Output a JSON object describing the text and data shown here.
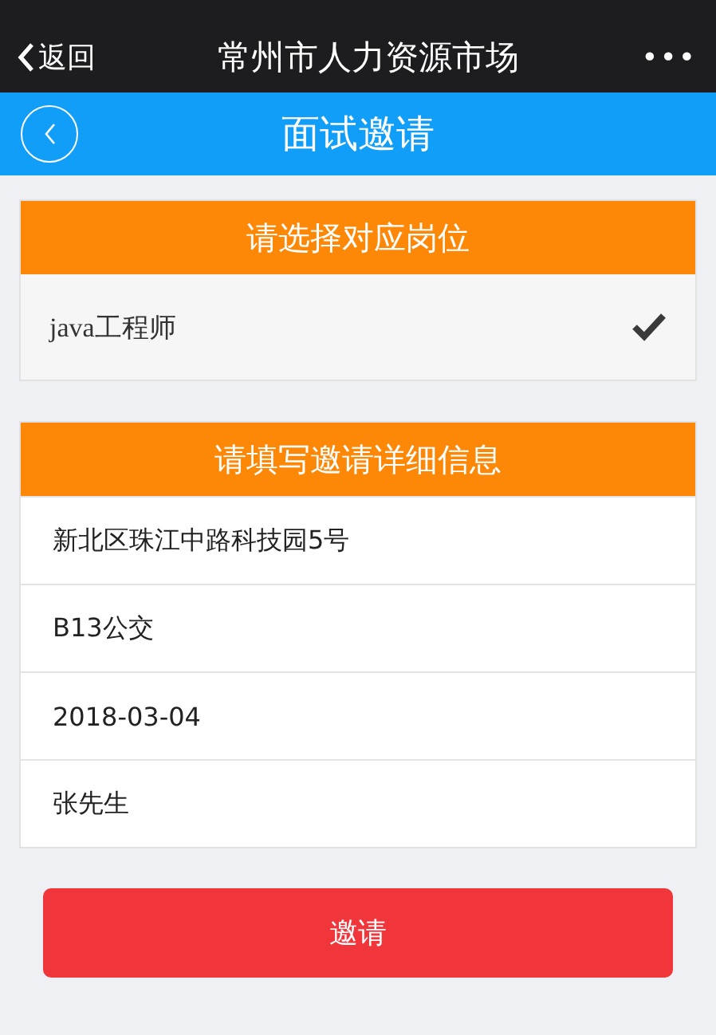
{
  "nav_bar": {
    "back": "返回",
    "title": "常州市人力资源市场",
    "more": "•••"
  },
  "header": {
    "title": "面试邀请"
  },
  "position_section": {
    "title": "请选择对应岗位",
    "options": [
      {
        "label": "java工程师",
        "selected": true
      }
    ]
  },
  "details_section": {
    "title": "请填写邀请详细信息",
    "fields": [
      {
        "value": "新北区珠江中路科技园5号"
      },
      {
        "value": "B13公交"
      },
      {
        "value": "2018-03-04"
      },
      {
        "value": "张先生"
      }
    ]
  },
  "submit_button": "邀请"
}
